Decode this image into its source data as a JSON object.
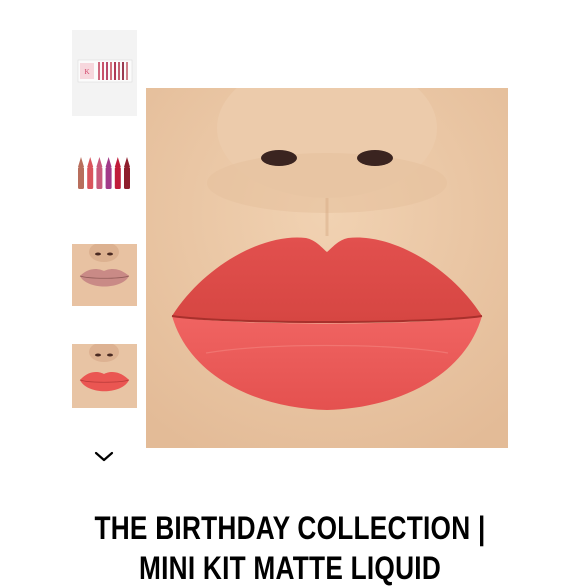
{
  "gallery": {
    "thumbnails": [
      {
        "name": "kit-box",
        "icon": "kit-box-thumbnail"
      },
      {
        "name": "lipstick-lineup",
        "icon": "lipstick-lineup-thumbnail",
        "colors": [
          "#b86e5c",
          "#d9545c",
          "#c85a7c",
          "#a23a8a",
          "#c01c3a",
          "#8e1e2c"
        ]
      },
      {
        "name": "lips-nude",
        "lip_color": "#c98a86"
      },
      {
        "name": "lips-coral",
        "lip_color": "#ea5652"
      }
    ],
    "scroll_icon": "chevron-down-icon",
    "main_image": {
      "subject": "lips-swatch",
      "lip_color": "#ea5a57",
      "skin_color": "#eccbaa"
    }
  },
  "product": {
    "title": "THE BIRTHDAY COLLECTION | MINI KIT MATTE LIQUID"
  }
}
